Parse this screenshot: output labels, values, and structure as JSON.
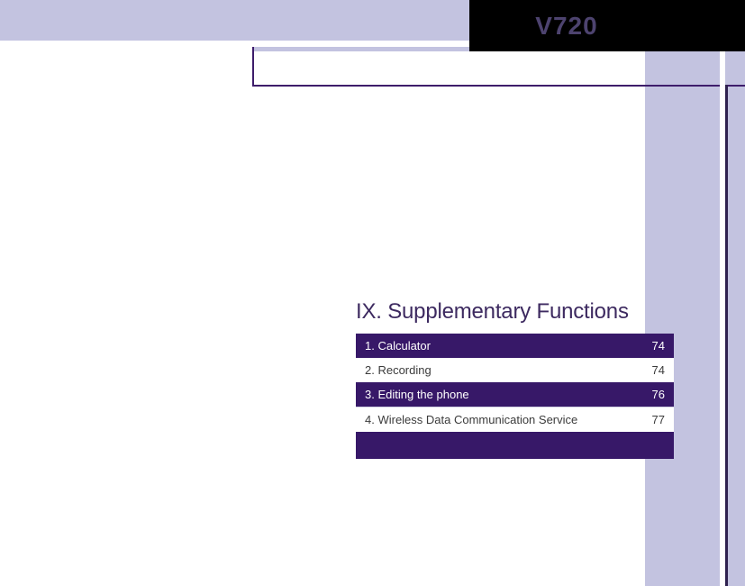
{
  "header": {
    "model": "V720"
  },
  "section": {
    "title": "IX. Supplementary Functions"
  },
  "toc": [
    {
      "label": "1. Calculator",
      "page": "74"
    },
    {
      "label": "2. Recording",
      "page": "74"
    },
    {
      "label": "3. Editing the phone",
      "page": "76"
    },
    {
      "label": "4. Wireless Data Communication Service",
      "page": "77"
    }
  ]
}
